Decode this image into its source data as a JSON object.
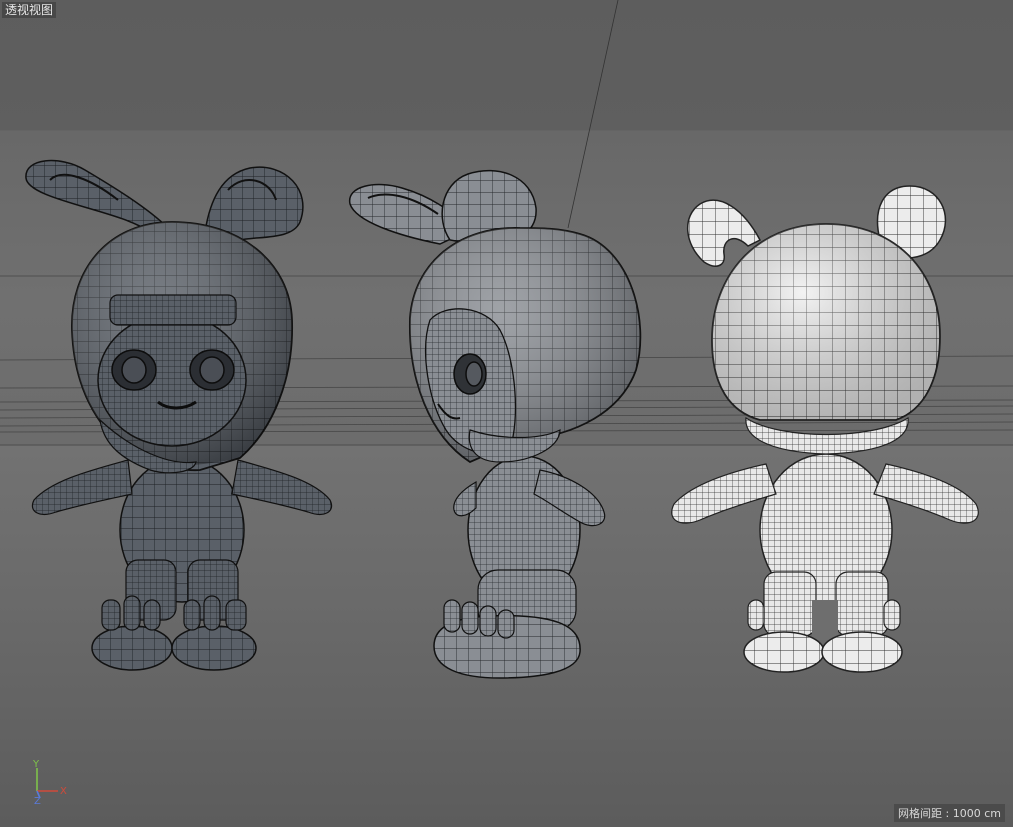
{
  "viewport": {
    "title": "透视视图",
    "grid_spacing_label": "网格间距 : 1000 cm"
  },
  "axis_gizmo": {
    "y_label": "Y",
    "x_label": "X",
    "z_label": "Z",
    "colors": {
      "y": "#7fc24a",
      "x": "#d04a3a",
      "z": "#5a7ad8"
    }
  },
  "models": [
    {
      "view": "front",
      "shade": "dark"
    },
    {
      "view": "side",
      "shade": "mid"
    },
    {
      "view": "back",
      "shade": "light"
    }
  ]
}
